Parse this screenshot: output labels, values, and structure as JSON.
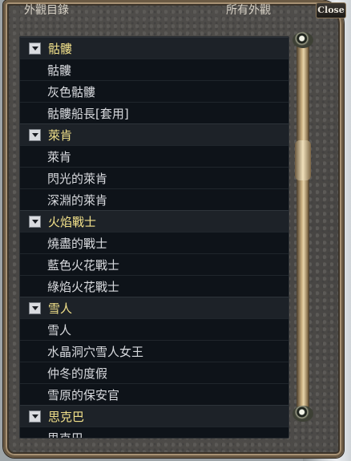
{
  "window": {
    "title_left": "外觀目錄",
    "title_right": "所有外觀",
    "close_label": "Close"
  },
  "groups": [
    {
      "name": "骷髏",
      "items": [
        "骷髏",
        "灰色骷髏",
        "骷髏船長[套用]"
      ]
    },
    {
      "name": "萊肯",
      "items": [
        "萊肯",
        "閃光的萊肯",
        "深淵的萊肯"
      ]
    },
    {
      "name": "火焰戰士",
      "items": [
        "燒盡的戰士",
        "藍色火花戰士",
        "綠焰火花戰士"
      ]
    },
    {
      "name": "雪人",
      "items": [
        "雪人",
        "水晶洞穴雪人女王",
        "仲冬的度假",
        "雪原的保安官"
      ]
    },
    {
      "name": "思克巴",
      "items": [
        "思克巴"
      ]
    }
  ]
}
